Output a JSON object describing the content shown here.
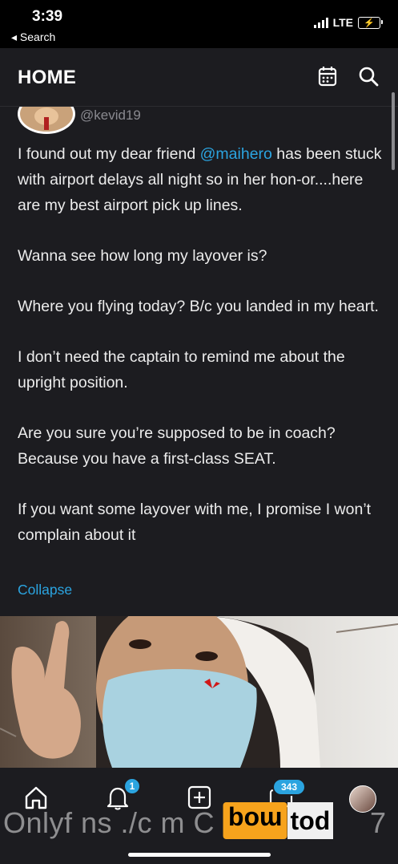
{
  "status_bar": {
    "time": "3:39",
    "back_label": "◂ Search",
    "network": "LTE"
  },
  "header": {
    "title": "HOME"
  },
  "post": {
    "handle": "@kevid19",
    "para1_before": "I found out my dear friend ",
    "mention": "@maihero",
    "para1_after": " has been stuck with airport delays all night so in her hon-or....here are my best airport pick up lines.",
    "para2": "Wanna see how long my layover is?",
    "para3": "Where you flying today? B/c you landed in my heart.",
    "para4": "I don’t need the captain to remind me about the upright position.",
    "para5": "Are you sure you’re supposed to be in coach? Because you have a first-class SEAT.",
    "para6": "If you want some layover with me, I promise I won’t complain about it",
    "collapse_label": "Collapse"
  },
  "tabbar": {
    "notifications_badge": "1",
    "messages_badge": "343"
  },
  "watermark": {
    "left_text": "Onlyf ns ./c m C",
    "inverted_text": "moq",
    "box_text": "tod",
    "tail_text": "7"
  },
  "colors": {
    "background": "#1c1c20",
    "accent": "#2ba4e0",
    "watermark_orange": "#f7a31c"
  }
}
